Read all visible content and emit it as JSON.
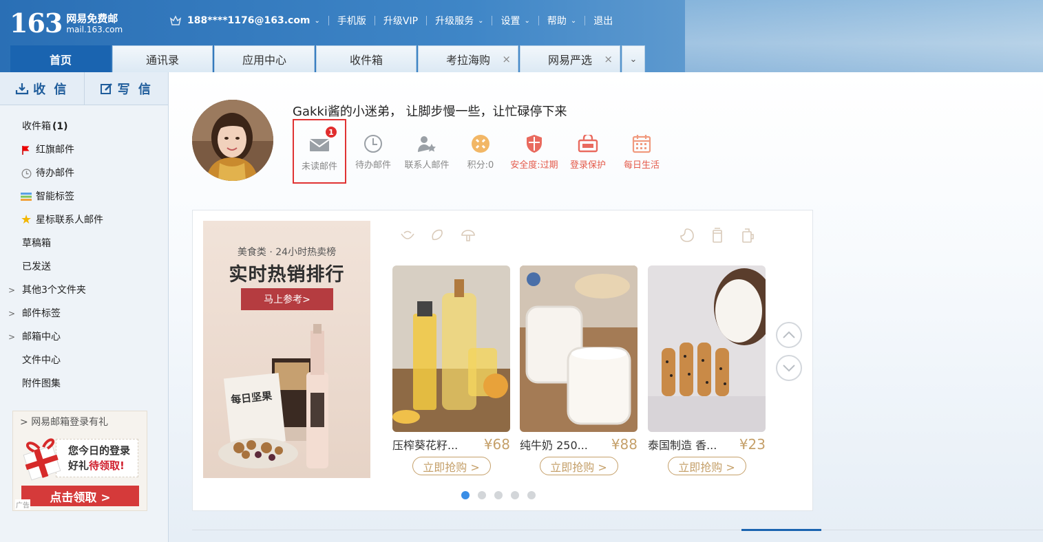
{
  "header": {
    "logo_num": "163",
    "logo_title": "网易免费邮",
    "logo_domain": "mail.163.com",
    "account_email": "188****1176@163.com",
    "links": [
      "手机版",
      "升级VIP",
      "升级服务",
      "设置",
      "帮助",
      "退出"
    ]
  },
  "tabs": [
    {
      "label": "首页"
    },
    {
      "label": "通讯录"
    },
    {
      "label": "应用中心"
    },
    {
      "label": "收件箱"
    },
    {
      "label": "考拉海购"
    },
    {
      "label": "网易严选"
    }
  ],
  "sidebar": {
    "receive_label": "收 信",
    "compose_label": "写 信",
    "inbox_label": "收件箱",
    "inbox_count": "(1)",
    "items": [
      {
        "label": "红旗邮件",
        "icon": "red-flag-icon"
      },
      {
        "label": "待办邮件",
        "icon": "clock-icon"
      },
      {
        "label": "智能标签",
        "icon": "color-tags-icon"
      },
      {
        "label": "星标联系人邮件",
        "icon": "star-icon"
      },
      {
        "label": "草稿箱"
      },
      {
        "label": "已发送"
      },
      {
        "label": "其他3个文件夹"
      },
      {
        "label": "邮件标签"
      },
      {
        "label": "邮箱中心"
      },
      {
        "label": "文件中心"
      },
      {
        "label": "附件图集"
      }
    ],
    "promo": {
      "title": "网易邮箱登录有礼",
      "line1": "您今日的登录",
      "line2_prefix": "好礼",
      "line2_highlight": "待领取!",
      "button": "点击领取 >",
      "ad_tag": "广告"
    }
  },
  "main": {
    "motto": "Gakki酱的小迷弟， 让脚步慢一些，让忙碌停下来",
    "stats": [
      {
        "label": "未读邮件",
        "icon": "envelope-icon",
        "badge": "1"
      },
      {
        "label": "待办邮件",
        "icon": "clock-icon"
      },
      {
        "label": "联系人邮件",
        "icon": "contact-star-icon"
      },
      {
        "label": "积分:0",
        "icon": "points-icon"
      },
      {
        "label": "安全度:过期",
        "icon": "shield-icon"
      },
      {
        "label": "登录保护",
        "icon": "lock-box-icon"
      },
      {
        "label": "每日生活",
        "icon": "calendar-icon"
      }
    ],
    "banner": {
      "category": "美食类 · 24小时热卖榜",
      "title": "实时热销排行",
      "button": "马上参考>"
    },
    "products": [
      {
        "name": "压榨葵花籽...",
        "price": "¥68",
        "buy": "立即抢购 >"
      },
      {
        "name": "纯牛奶 250...",
        "price": "¥88",
        "buy": "立即抢购 >"
      },
      {
        "name": "泰国制造 香...",
        "price": "¥23",
        "buy": "立即抢购 >"
      }
    ],
    "carousel_pages": 5,
    "carousel_active": 1
  },
  "colors": {
    "brand_blue": "#1a64b0",
    "price_gold": "#c5a06a",
    "alert_red": "#e02d2d"
  }
}
